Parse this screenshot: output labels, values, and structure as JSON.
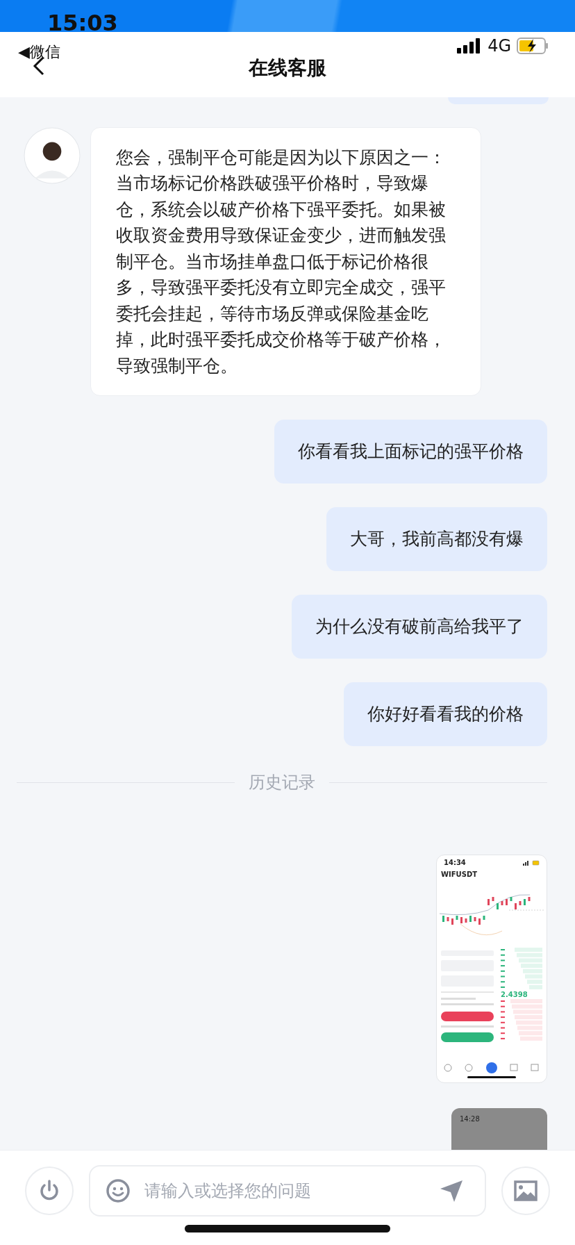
{
  "status_bar": {
    "time": "15:03",
    "network": "4G"
  },
  "nav": {
    "back_label": "◀微信",
    "title": "在线客服"
  },
  "messages": [
    {
      "kind": "agent",
      "text": "您会，强制平仓可能是因为以下原因之一：当市场标记价格跌破强平价格时，导致爆仓，系统会以破产价格下强平委托。如果被收取资金费用导致保证金变少，进而触发强制平仓。当市场挂单盘口低于标记价格很多，导致强平委托没有立即完全成交，强平委托会挂起，等待市场反弹或保险基金吃掉，此时强平委托成交价格等于破产价格，导致强制平仓。"
    },
    {
      "kind": "user",
      "text": "你看看我上面标记的强平价格"
    },
    {
      "kind": "user",
      "text": "大哥，我前高都没有爆"
    },
    {
      "kind": "user",
      "text": "为什么没有破前高给我平了"
    },
    {
      "kind": "user",
      "text": "你好好看看我的价格"
    }
  ],
  "divider": "历史记录",
  "attachments": [
    {
      "kind": "screenshot",
      "time": "14:34",
      "symbol": "WIFUSDT",
      "price": "2.4398"
    },
    {
      "kind": "screenshot_partial",
      "time": "14:28"
    }
  ],
  "input": {
    "placeholder": "请输入或选择您的问题"
  }
}
